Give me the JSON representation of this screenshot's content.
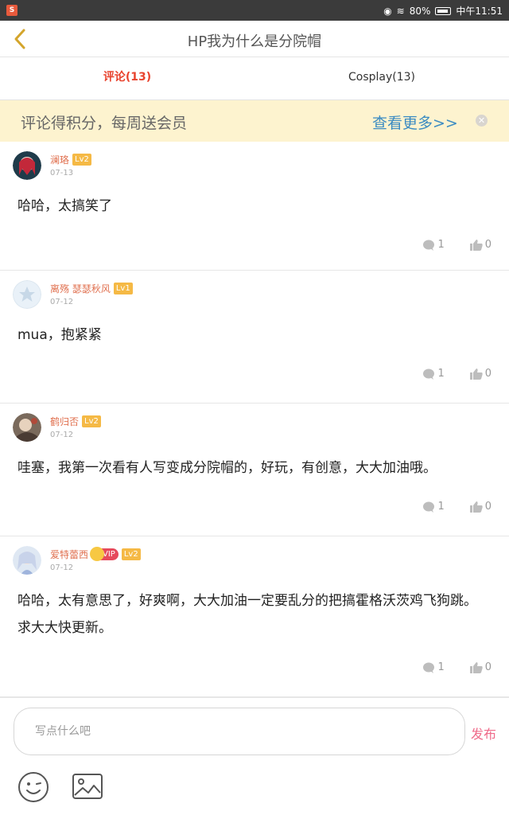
{
  "status_bar": {
    "battery": "80%",
    "time": "中午11:51"
  },
  "header": {
    "title": "HP我为什么是分院帽"
  },
  "tabs": [
    {
      "label": "评论(13)",
      "active": true
    },
    {
      "label": "Cosplay(13)",
      "active": false
    }
  ],
  "banner": {
    "text": "评论得积分，每周送会员",
    "more": "查看更多>>"
  },
  "comments": [
    {
      "name": "澜珞",
      "level": "Lv2",
      "vip": false,
      "date": "07-13",
      "text": "哈哈，太搞笑了",
      "replies": "1",
      "likes": "0"
    },
    {
      "name": "离殇 瑟瑟秋风",
      "level": "Lv1",
      "vip": false,
      "date": "07-12",
      "text": "mua，抱紧紧",
      "replies": "1",
      "likes": "0"
    },
    {
      "name": "鹤归否",
      "level": "Lv2",
      "vip": false,
      "date": "07-12",
      "text": "哇塞，我第一次看有人写变成分院帽的，好玩，有创意，大大加油哦。",
      "replies": "1",
      "likes": "0"
    },
    {
      "name": "爱特蕾西",
      "level": "Lv2",
      "vip": true,
      "vip_label": "VIP",
      "date": "07-12",
      "text": "哈哈，太有意思了，好爽啊，大大加油一定要乱分的把搞霍格沃茨鸡飞狗跳。求大大快更新。",
      "replies": "1",
      "likes": "0"
    }
  ],
  "input": {
    "placeholder": "写点什么吧",
    "publish_label": "发布"
  },
  "colors": {
    "accent": "#e8442f",
    "banner_bg": "#fdf3cf",
    "link": "#3b8bc2",
    "publish": "#ef6b8a",
    "username": "#e0704f",
    "level_badge": "#f5b945"
  },
  "icons": {
    "back": "chevron-left-icon",
    "close": "close-icon",
    "reply": "comment-bubble-icon",
    "like": "thumbs-up-icon",
    "emoji": "smiley-icon",
    "image": "image-icon"
  }
}
